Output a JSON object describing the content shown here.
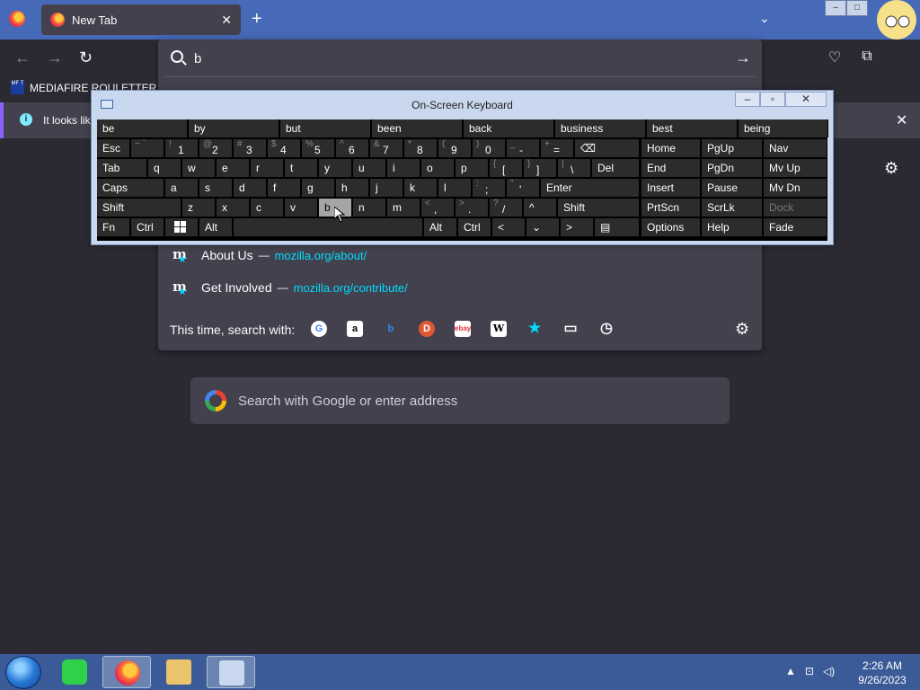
{
  "browser": {
    "tab_title": "New Tab",
    "tab_close": "✕",
    "new_tab": "+",
    "tab_list": "⌄",
    "url_text": "b",
    "go_arrow": "→",
    "bookmark_label": "MEDIAFIRE ROULETTER",
    "bookmark_icon_text": "MF T",
    "notice_text": "It looks like",
    "notice_close": "✕"
  },
  "results": [
    {
      "title": "About Us",
      "dash": "—",
      "url": "mozilla.org/about/"
    },
    {
      "title": "Get Involved",
      "dash": "—",
      "url": "mozilla.org/contribute/"
    }
  ],
  "engines": {
    "label": "This time, search with:",
    "icons": [
      "google-icon",
      "amazon-icon",
      "bing-icon",
      "duckduckgo-icon",
      "ebay-icon",
      "wikipedia-icon",
      "bookmarks-icon",
      "tabs-icon",
      "history-icon"
    ],
    "glyphs": [
      "G",
      "a",
      "b",
      "D",
      "ebay",
      "W",
      "★",
      "▭",
      "◷"
    ]
  },
  "searchbox": {
    "placeholder": "Search with Google or enter address"
  },
  "osk": {
    "title": "On-Screen Keyboard",
    "predictions": [
      "be",
      "by",
      "but",
      "been",
      "back",
      "business",
      "best",
      "being"
    ],
    "row1": {
      "esc": "Esc",
      "keys": [
        [
          "~ `",
          ""
        ],
        [
          "!",
          "1"
        ],
        [
          "@",
          "2"
        ],
        [
          "#",
          "3"
        ],
        [
          "$",
          "4"
        ],
        [
          "%",
          "5"
        ],
        [
          "^",
          "6"
        ],
        [
          "&",
          "7"
        ],
        [
          "*",
          "8"
        ],
        [
          "(",
          "9"
        ],
        [
          ")",
          "0"
        ],
        [
          "_",
          "-"
        ],
        [
          "+",
          "="
        ]
      ],
      "backspace": "⌫"
    },
    "row2": {
      "tab": "Tab",
      "keys": [
        "q",
        "w",
        "e",
        "r",
        "t",
        "y",
        "u",
        "i",
        "o",
        "p"
      ],
      "brackets": [
        [
          "{",
          "["
        ],
        [
          "}",
          "]"
        ],
        [
          "|",
          "\\"
        ]
      ],
      "del": "Del"
    },
    "row3": {
      "caps": "Caps",
      "keys": [
        "a",
        "s",
        "d",
        "f",
        "g",
        "h",
        "j",
        "k",
        "l"
      ],
      "punct": [
        [
          ":",
          ";"
        ],
        [
          "\"",
          "'"
        ]
      ],
      "enter": "Enter"
    },
    "row4": {
      "shift": "Shift",
      "keys": [
        "z",
        "x",
        "c",
        "v",
        "b",
        "n",
        "m"
      ],
      "punct": [
        [
          "<",
          ","
        ],
        [
          ">",
          "."
        ],
        [
          "?",
          "/"
        ]
      ],
      "up": "^",
      "shift_r": "Shift"
    },
    "row5": {
      "fn": "Fn",
      "ctrl": "Ctrl",
      "alt": "Alt",
      "alt_r": "Alt",
      "ctrl_r": "Ctrl",
      "left": "<",
      "down": "⌄",
      "right": ">",
      "menu": "▤"
    },
    "nav": [
      [
        "Home",
        "PgUp",
        "Nav"
      ],
      [
        "End",
        "PgDn",
        "Mv Up"
      ],
      [
        "Insert",
        "Pause",
        "Mv Dn"
      ],
      [
        "PrtScn",
        "ScrLk",
        "Dock"
      ],
      [
        "Options",
        "Help",
        "Fade"
      ]
    ]
  },
  "taskbar": {
    "time": "2:26 AM",
    "date": "9/26/2023"
  },
  "colors": {
    "tabbar": "#4669b8",
    "panel": "#42414d",
    "page": "#2b2a33",
    "link": "#00ddff",
    "taskbar": "#3b5b98"
  }
}
